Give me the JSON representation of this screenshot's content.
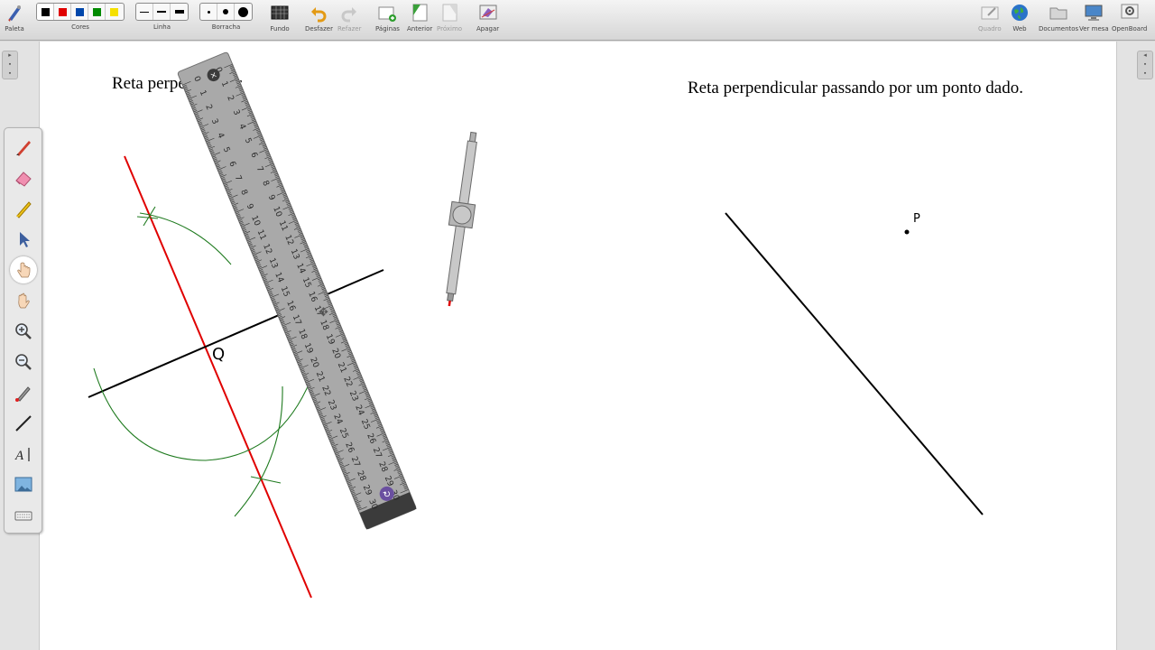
{
  "toolbar": {
    "palette": "Paleta",
    "colors": "Cores",
    "line": "Linha",
    "eraser": "Borracha",
    "background": "Fundo",
    "undo": "Desfazer",
    "redo": "Refazer",
    "pages": "Páginas",
    "previous": "Anterior",
    "next": "Próximo",
    "erase": "Apagar",
    "board": "Quadro",
    "web": "Web",
    "documents": "Documentos",
    "desktop": "Ver mesa",
    "openboard": "OpenBoard"
  },
  "color_swatches": [
    "#000000",
    "#e00000",
    "#0047ab",
    "#008a00",
    "#f5e000"
  ],
  "board": {
    "title_left": "Reta perpendicular",
    "title_right": "Reta perpendicular passando por um ponto dado.",
    "label_q": "Q",
    "label_p": "P"
  },
  "ruler": {
    "ticks": [
      "0",
      "1",
      "2",
      "3",
      "4",
      "5",
      "6",
      "7",
      "8",
      "9",
      "10",
      "11",
      "12",
      "13",
      "14",
      "15",
      "16",
      "17",
      "18",
      "19",
      "20",
      "21",
      "22",
      "23",
      "24",
      "25",
      "26",
      "27",
      "28",
      "29",
      "30"
    ]
  },
  "colors": {
    "red_line": "#e00000",
    "arc": "#1e7a1e",
    "ruler_body": "#a9a9a9"
  }
}
